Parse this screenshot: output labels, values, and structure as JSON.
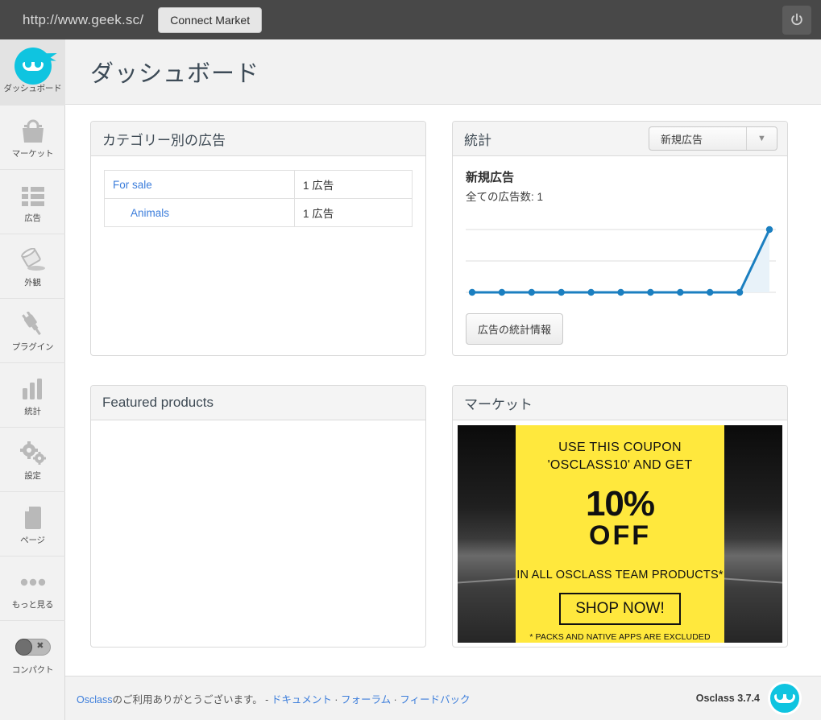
{
  "topbar": {
    "site_url": "http://www.geek.sc/",
    "connect_market_label": "Connect Market",
    "power_icon": "power-icon"
  },
  "sidebar": {
    "items": [
      {
        "label": "ダッシュボード",
        "icon": "ninja-logo-icon",
        "active": true
      },
      {
        "label": "マーケット",
        "icon": "shopping-bag-icon",
        "active": false
      },
      {
        "label": "広告",
        "icon": "list-icon",
        "active": false
      },
      {
        "label": "外観",
        "icon": "paint-bucket-icon",
        "active": false
      },
      {
        "label": "プラグイン",
        "icon": "plug-icon",
        "active": false
      },
      {
        "label": "統計",
        "icon": "bar-chart-icon",
        "active": false
      },
      {
        "label": "設定",
        "icon": "gears-icon",
        "active": false
      },
      {
        "label": "ページ",
        "icon": "page-icon",
        "active": false
      },
      {
        "label": "もっと見る",
        "icon": "ellipsis-icon",
        "active": false
      }
    ],
    "compact": {
      "label": "コンパクト",
      "icon": "toggle-switch-icon",
      "state": "off"
    }
  },
  "header": {
    "title": "ダッシュボード"
  },
  "categories_panel": {
    "title": "カテゴリー別の広告",
    "rows": [
      {
        "name": "For sale",
        "count": "1 広告",
        "child": false
      },
      {
        "name": "Animals",
        "count": "1 広告",
        "child": true
      }
    ]
  },
  "stats_panel": {
    "title": "統計",
    "select_value": "新規広告",
    "select_options": [
      "新規広告"
    ],
    "heading": "新規広告",
    "subtitle": "全ての広告数: 1",
    "button_label": "広告の統計情報"
  },
  "chart_data": {
    "type": "line",
    "title": "新規広告",
    "x": [
      1,
      2,
      3,
      4,
      5,
      6,
      7,
      8,
      9,
      10,
      11
    ],
    "categories": [
      "",
      "",
      "",
      "",
      "",
      "",
      "",
      "",
      "",
      "",
      ""
    ],
    "values": [
      0,
      0,
      0,
      0,
      0,
      0,
      0,
      0,
      0,
      0,
      1
    ],
    "series": [
      {
        "name": "新規広告",
        "values": [
          0,
          0,
          0,
          0,
          0,
          0,
          0,
          0,
          0,
          0,
          1
        ]
      }
    ],
    "xlabel": "",
    "ylabel": "",
    "ylim": [
      0,
      1
    ],
    "grid": true,
    "gridlines": [
      0,
      0.5,
      1
    ],
    "legend": "none",
    "line_color": "#1b7fc0",
    "fill_color": "#e8f2f9",
    "point_color": "#1b7fc0",
    "total_label": "全ての広告数: 1"
  },
  "featured_panel": {
    "title": "Featured products"
  },
  "market_panel": {
    "title": "マーケット",
    "banner": {
      "line1": "USE THIS COUPON",
      "line2": "'OSCLASS10' AND GET",
      "big": "10%",
      "off": "OFF",
      "line3": "IN ALL OSCLASS TEAM PRODUCTS*",
      "shop_label": "SHOP NOW!",
      "note": "* PACKS AND NATIVE APPS ARE EXCLUDED",
      "bg_color": "#ffe83d"
    }
  },
  "footer": {
    "thanks_prefix": "Osclass",
    "thanks_text": "のご利用ありがとうございます。 - ",
    "link_docs": "ドキュメント",
    "sep1": " · ",
    "link_forum": "フォーラム",
    "sep2": " · ",
    "link_feedback": "フィードバック",
    "version": "Osclass 3.7.4",
    "logo_icon": "ninja-logo-icon"
  },
  "theme": {
    "accent": "#0fc4e0",
    "link": "#3d7edb",
    "topbar_bg": "#484848",
    "sidebar_bg": "#f2f2f2",
    "chart_blue": "#1b7fc0"
  }
}
